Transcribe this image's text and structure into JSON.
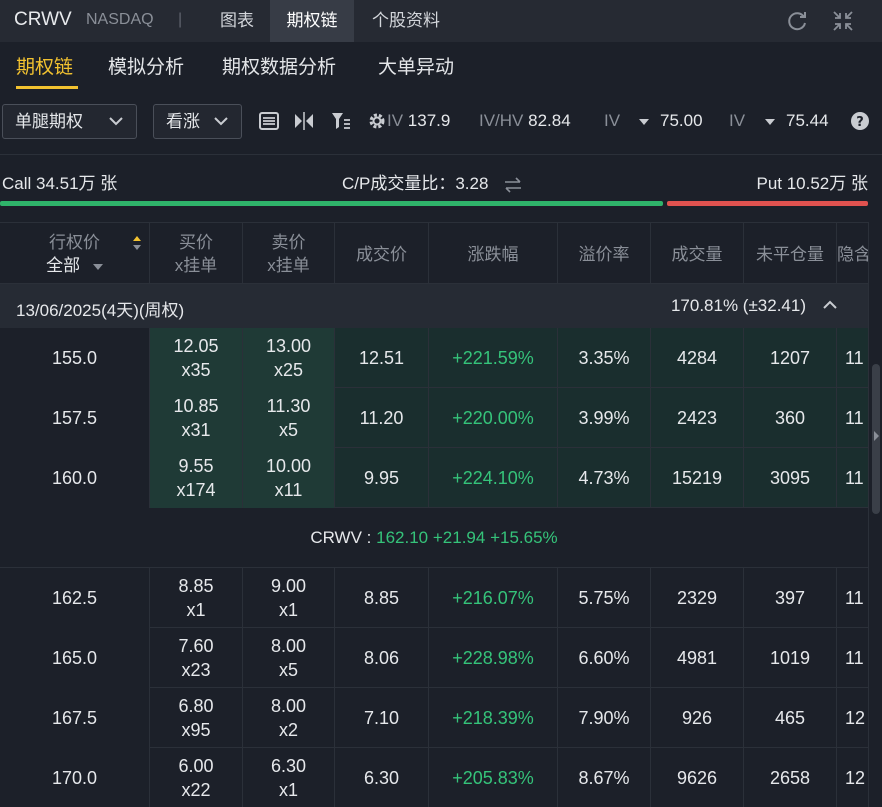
{
  "header": {
    "ticker": "CRWV",
    "exchange": "NASDAQ",
    "separator": "|",
    "tabs": [
      "图表",
      "期权链",
      "个股资料"
    ],
    "active_tab": 1
  },
  "subtabs": {
    "items": [
      "期权链",
      "模拟分析",
      "期权数据分析",
      "大单异动"
    ],
    "active": 0
  },
  "toolbar": {
    "type_select": "单腿期权",
    "direction_select": "看涨",
    "iv_label": "IV",
    "iv_value": "137.9",
    "ivhv_label": "IV/HV",
    "ivhv_value": "82.84",
    "ivp_label": "IV",
    "ivp_value": "75.00",
    "ivr_label": "IV",
    "ivr_value": "75.44"
  },
  "volume_bar": {
    "call": "Call 34.51万 张",
    "ratio": "C/P成交量比：3.28",
    "put": "Put 10.52万 张",
    "call_share": 0.766,
    "call_color": "#2fb36a",
    "put_color": "#e0524f"
  },
  "table": {
    "headers": {
      "strike": "行权价",
      "strike_filter": "全部",
      "bid": [
        "买价",
        "x挂单"
      ],
      "ask": [
        "卖价",
        "x挂单"
      ],
      "last": "成交价",
      "change": "涨跌幅",
      "premium": "溢价率",
      "volume": "成交量",
      "oi": "未平仓量",
      "iv": "隐含"
    },
    "expiry": {
      "date": "13/06/2025(4天)(周权)",
      "iv": "170.81% (±32.41)"
    },
    "rows_itm": [
      {
        "strike": "155.0",
        "bid": "12.05",
        "bid_size": "x35",
        "ask": "13.00",
        "ask_size": "x25",
        "last": "12.51",
        "change": "+221.59%",
        "premium": "3.35%",
        "volume": "4284",
        "oi": "1207",
        "iv": "11"
      },
      {
        "strike": "157.5",
        "bid": "10.85",
        "bid_size": "x31",
        "ask": "11.30",
        "ask_size": "x5",
        "last": "11.20",
        "change": "+220.00%",
        "premium": "3.99%",
        "volume": "2423",
        "oi": "360",
        "iv": "11"
      },
      {
        "strike": "160.0",
        "bid": "9.55",
        "bid_size": "x174",
        "ask": "10.00",
        "ask_size": "x11",
        "last": "9.95",
        "change": "+224.10%",
        "premium": "4.73%",
        "volume": "15219",
        "oi": "3095",
        "iv": "11"
      }
    ],
    "underlying": {
      "symbol": "CRWV :",
      "price": "162.10",
      "change": "+21.94",
      "change_pct": "+15.65%"
    },
    "rows_otm": [
      {
        "strike": "162.5",
        "bid": "8.85",
        "bid_size": "x1",
        "ask": "9.00",
        "ask_size": "x1",
        "last": "8.85",
        "change": "+216.07%",
        "premium": "5.75%",
        "volume": "2329",
        "oi": "397",
        "iv": "11"
      },
      {
        "strike": "165.0",
        "bid": "7.60",
        "bid_size": "x23",
        "ask": "8.00",
        "ask_size": "x5",
        "last": "8.06",
        "change": "+228.98%",
        "premium": "6.60%",
        "volume": "4981",
        "oi": "1019",
        "iv": "11"
      },
      {
        "strike": "167.5",
        "bid": "6.80",
        "bid_size": "x95",
        "ask": "8.00",
        "ask_size": "x2",
        "last": "7.10",
        "change": "+218.39%",
        "premium": "7.90%",
        "volume": "926",
        "oi": "465",
        "iv": "12"
      },
      {
        "strike": "170.0",
        "bid": "6.00",
        "bid_size": "x22",
        "ask": "6.30",
        "ask_size": "x1",
        "last": "6.30",
        "change": "+205.83%",
        "premium": "8.67%",
        "volume": "9626",
        "oi": "2658",
        "iv": "12"
      }
    ]
  }
}
